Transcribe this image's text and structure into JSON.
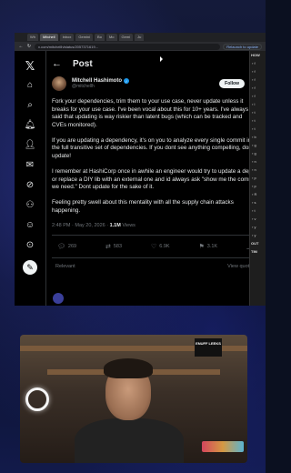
{
  "browser": {
    "tabs": [
      "Wh",
      "Mitchell",
      "Inbox",
      "Gemini",
      "Bo",
      "Mo",
      "Gemi",
      "Ju"
    ],
    "url": "x.com/mitchellh/status/2057371619...",
    "relaunch_label": "Relaunch to update"
  },
  "app": {
    "header_title": "Post",
    "author": {
      "name": "Mitchell Hashimoto",
      "handle": "@mitchellh"
    },
    "follow_label": "Follow",
    "paragraphs": [
      "Fork your dependencies, trim them to your use case, never update unless it breaks for your use case. I've been vocal about this for 10+ years. I've always said that updating is way riskier than latent bugs (which can be tracked and CVEs monitored).",
      "If you are updating a dependency, it's on you to analyze every single commit in the full transitive set of dependencies. If you dont see anything compelling, dont update!",
      "I remember at HashiCorp once in awhile an engineer would try to update a dep or replace a DIY lib with an external one and id always ask \"show me the commit we need.\" Dont update for the sake of it.",
      "Feeling pretty swell about this mentality with all the supply chain attacks happening."
    ],
    "timestamp": "2:48 PM · May 20, 2026 ·",
    "views": "1.1M",
    "views_label": "Views",
    "actions": {
      "reply": "269",
      "repost": "583",
      "like": "6.9K",
      "bookmark": "3.1K"
    },
    "relevant_label": "Relevant",
    "view_quotes_label": "View quotes"
  },
  "ide": {
    "header": "HOW",
    "labels": [
      "OUT",
      "TIM"
    ]
  },
  "webcam": {
    "sign_text": "ENUFF LEEKS"
  }
}
